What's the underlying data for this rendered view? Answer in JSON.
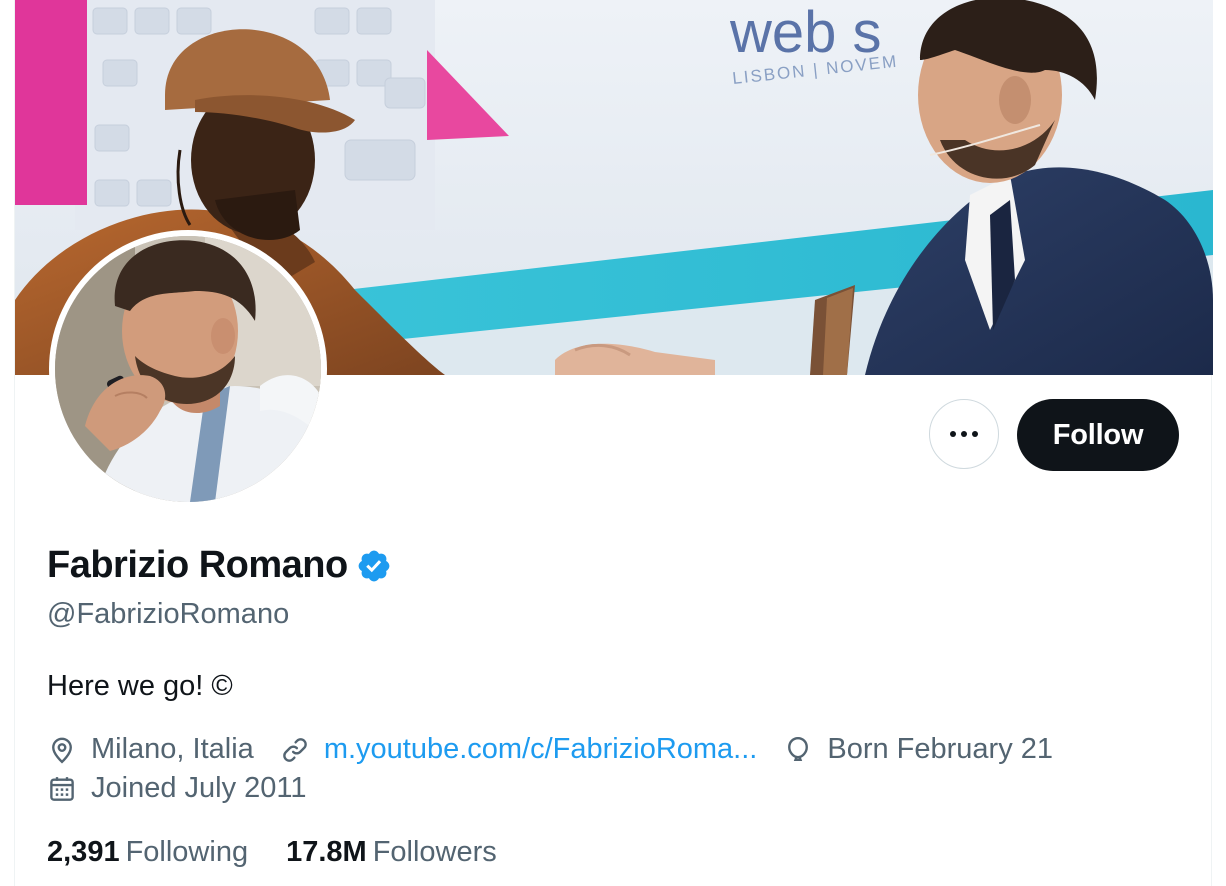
{
  "profile": {
    "display_name": "Fabrizio Romano",
    "handle": "@FabrizioRomano",
    "bio": "Here we go! ©",
    "verified": true,
    "location": "Milano, Italia",
    "website": "m.youtube.com/c/FabrizioRoma...",
    "birthday": "Born February 21",
    "joined": "Joined July 2011"
  },
  "banner": {
    "sign_text_main": "web s",
    "sign_text_sub": "LISBON | NOVEM"
  },
  "counts": {
    "following_value": "2,391",
    "following_label": "Following",
    "followers_value": "17.8M",
    "followers_label": "Followers"
  },
  "actions": {
    "follow_label": "Follow",
    "more_icon": "more-dots-icon"
  },
  "icons": {
    "location": "location-pin-icon",
    "website": "link-icon",
    "birthday": "balloon-icon",
    "joined": "calendar-icon",
    "verified": "verified-badge-icon"
  },
  "colors": {
    "accent": "#1d9bf0",
    "text_primary": "#0f1419",
    "text_secondary": "#536471",
    "follow_button_bg": "#0f1419"
  }
}
